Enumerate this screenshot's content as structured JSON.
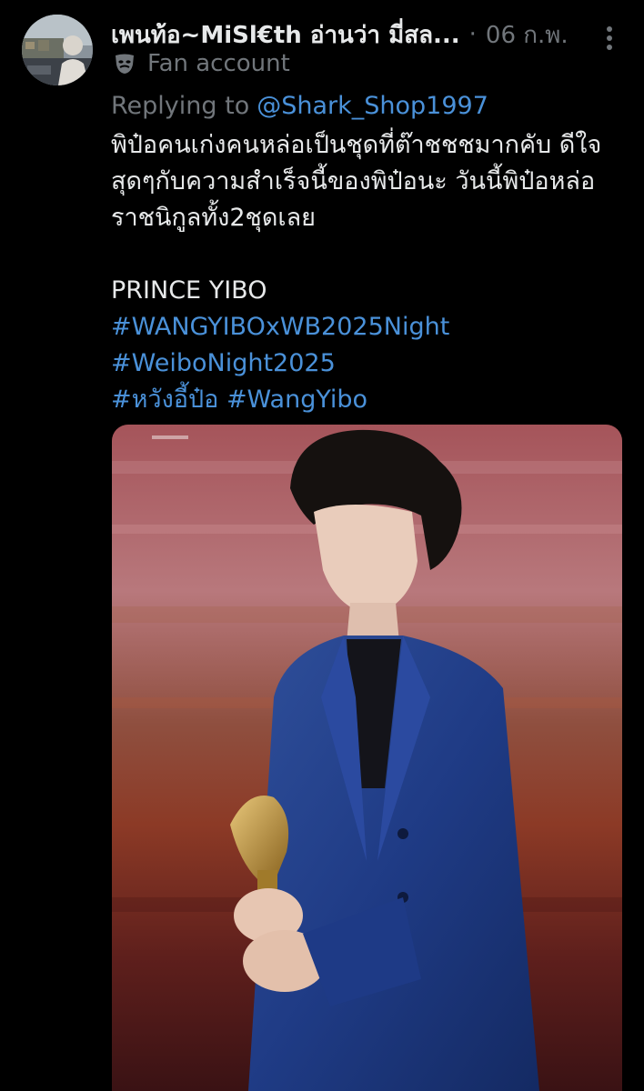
{
  "tweet": {
    "display_name": "เพนท้อ~MiSl€th อ่านว่า มี่สล...",
    "separator": "·",
    "date": "06 ก.พ.",
    "account_label": "Fan account",
    "account_label_icon": "theater-masks-icon",
    "replying_prefix": "Replying to",
    "replying_to": "@Shark_Shop1997",
    "text_lines": [
      "พิป๋อคนเก่งคนหล่อเป็นชุดที่ต๊าชชชมากคับ ดีใจ",
      "สุดๆกับความสำเร็จนี้ของพิป๋อนะ วันนี้พิป๋อหล่อ",
      "ราชนิกูลทั้ง2ชุดเลย",
      "",
      "PRINCE YIBO"
    ],
    "hashtags": {
      "line1": "#WANGYIBOxWB2025Night",
      "line2": "#WeiboNight2025",
      "line3a": "#หวังอี้ป๋อ",
      "line3b": "#WangYibo"
    },
    "more_icon": "more-vertical-icon",
    "media_description_icon": "photo"
  },
  "colors": {
    "background": "#000000",
    "primary_text": "#e7e9ea",
    "secondary_text": "#71767b",
    "link": "#4a91d9"
  }
}
